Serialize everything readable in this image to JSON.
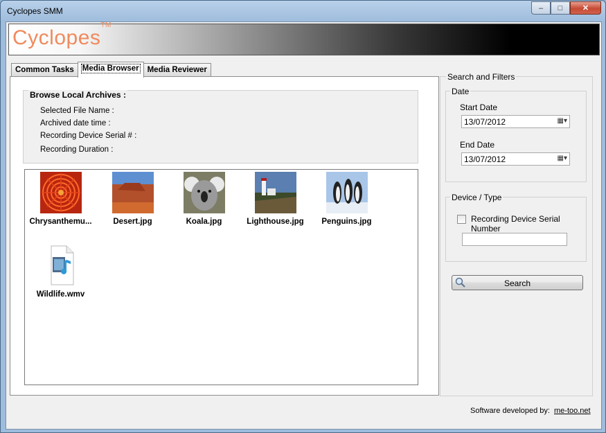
{
  "window": {
    "title": "Cyclopes SMM",
    "minimize": "–",
    "maximize": "□",
    "close": "✕"
  },
  "banner": {
    "logo": "Cyclopes",
    "tm": "TM"
  },
  "tabs": [
    "Common Tasks",
    "Media Browser",
    "Media Reviewer"
  ],
  "browse": {
    "title": "Browse Local Archives :",
    "fields": [
      "Selected File Name :",
      "Archived date time :",
      "Recording Device Serial # :",
      "Recording Duration :"
    ]
  },
  "files": [
    {
      "name": "Chrysanthemu...",
      "icon": "chrysanthemum-image"
    },
    {
      "name": "Desert.jpg",
      "icon": "desert-image"
    },
    {
      "name": "Koala.jpg",
      "icon": "koala-image"
    },
    {
      "name": "Lighthouse.jpg",
      "icon": "lighthouse-image"
    },
    {
      "name": "Penguins.jpg",
      "icon": "penguins-image"
    },
    {
      "name": "Wildlife.wmv",
      "icon": "video-file-icon"
    }
  ],
  "filters": {
    "title": "Search and Filters",
    "date_group": "Date",
    "start_label": "Start Date",
    "start_value": "13/07/2012",
    "end_label": "End Date",
    "end_value": "13/07/2012",
    "device_group": "Device / Type",
    "serial_checkbox_label": "Recording Device Serial Number",
    "serial_value": "",
    "search_button": "Search"
  },
  "footer": {
    "developed_by": "Software developed by:",
    "link": "me-too.net"
  },
  "colors": {
    "logo": "#f08a5d",
    "title_bar": "#b9d1ea",
    "close_button": "#c74a33"
  }
}
